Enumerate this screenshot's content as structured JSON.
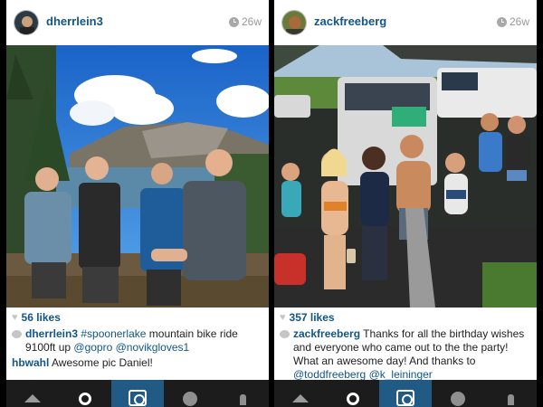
{
  "posts": [
    {
      "username": "dherrlein3",
      "time": "26w",
      "likes": "56 likes",
      "caption": {
        "author": "dherrlein3",
        "hashtag": "#spoonerlake",
        "text1": " mountain bike ride 9100ft up ",
        "mention1": "@gopro",
        "mention2": "@novikgloves1"
      },
      "comment": {
        "author": "hbwahl",
        "text": " Awesome pic Daniel!"
      }
    },
    {
      "username": "zackfreeberg",
      "time": "26w",
      "likes": "357 likes",
      "caption": {
        "author": "zackfreeberg",
        "text1": " Thanks for all the birthday wishes and everyone who came out to the the party! What an awesome day! And thanks to ",
        "mention1": "@toddfreeberg",
        "mention2": "@k_leininger"
      }
    }
  ],
  "tabbar": {
    "active": "camera",
    "items": [
      "home-icon",
      "search-icon",
      "camera-icon",
      "activity-icon",
      "profile-icon"
    ]
  },
  "colors": {
    "link": "#125688",
    "tab_active": "#215b85",
    "tabbar": "#1c1c1c"
  }
}
